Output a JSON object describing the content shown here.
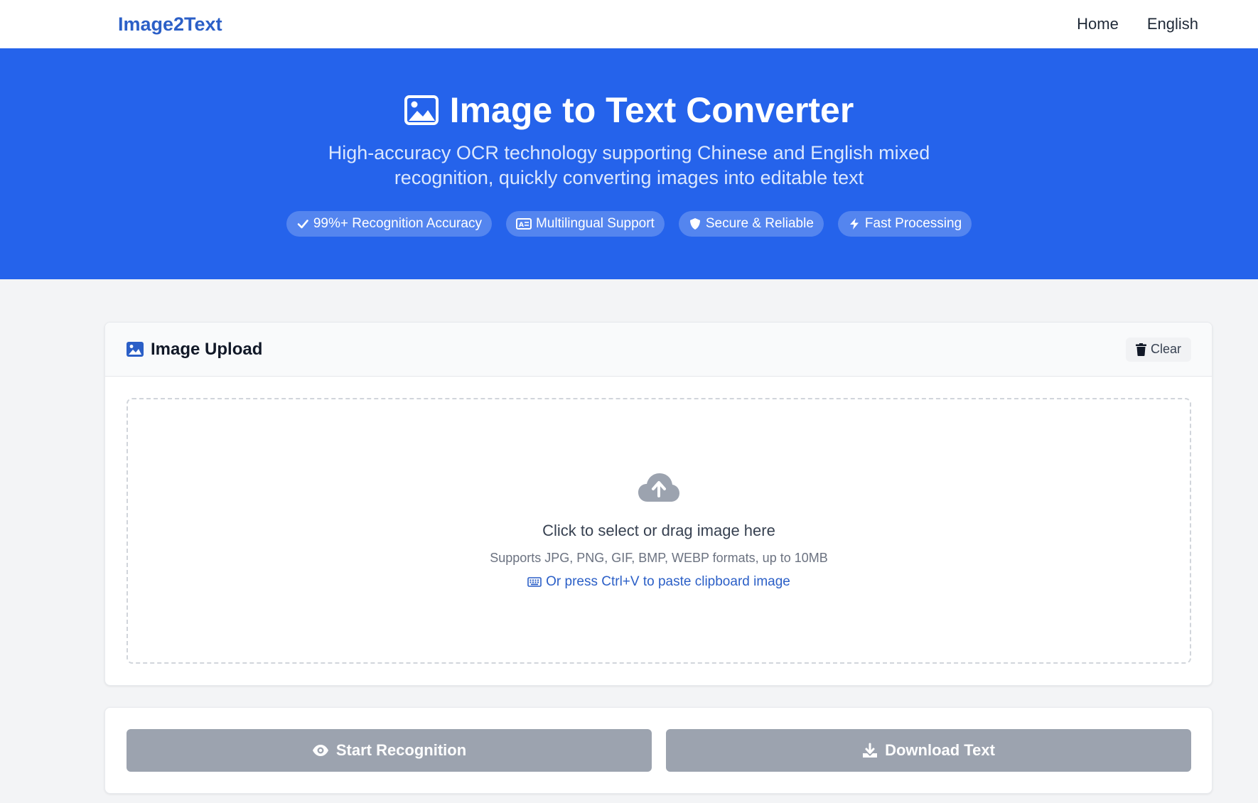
{
  "nav": {
    "brand": "Image2Text",
    "links": [
      "Home",
      "English"
    ]
  },
  "hero": {
    "title": "Image to Text Converter",
    "subtitle": "High-accuracy OCR technology supporting Chinese and English mixed recognition, quickly converting images into editable text",
    "badges": [
      {
        "icon": "check-icon",
        "label": "99%+ Recognition Accuracy"
      },
      {
        "icon": "language-icon",
        "label": "Multilingual Support"
      },
      {
        "icon": "shield-icon",
        "label": "Secure & Reliable"
      },
      {
        "icon": "bolt-icon",
        "label": "Fast Processing"
      }
    ]
  },
  "upload": {
    "title": "Image Upload",
    "clear_label": "Clear",
    "drop_text": "Click to select or drag image here",
    "formats_text": "Supports JPG, PNG, GIF, BMP, WEBP formats, up to 10MB",
    "paste_text": "Or press Ctrl+V to paste clipboard image"
  },
  "actions": {
    "start_label": "Start Recognition",
    "download_label": "Download Text"
  },
  "colors": {
    "brand": "#2b5fc7",
    "hero_bg": "#2563eb",
    "disabled_btn": "#9ca3af",
    "page_bg": "#f3f4f6"
  }
}
